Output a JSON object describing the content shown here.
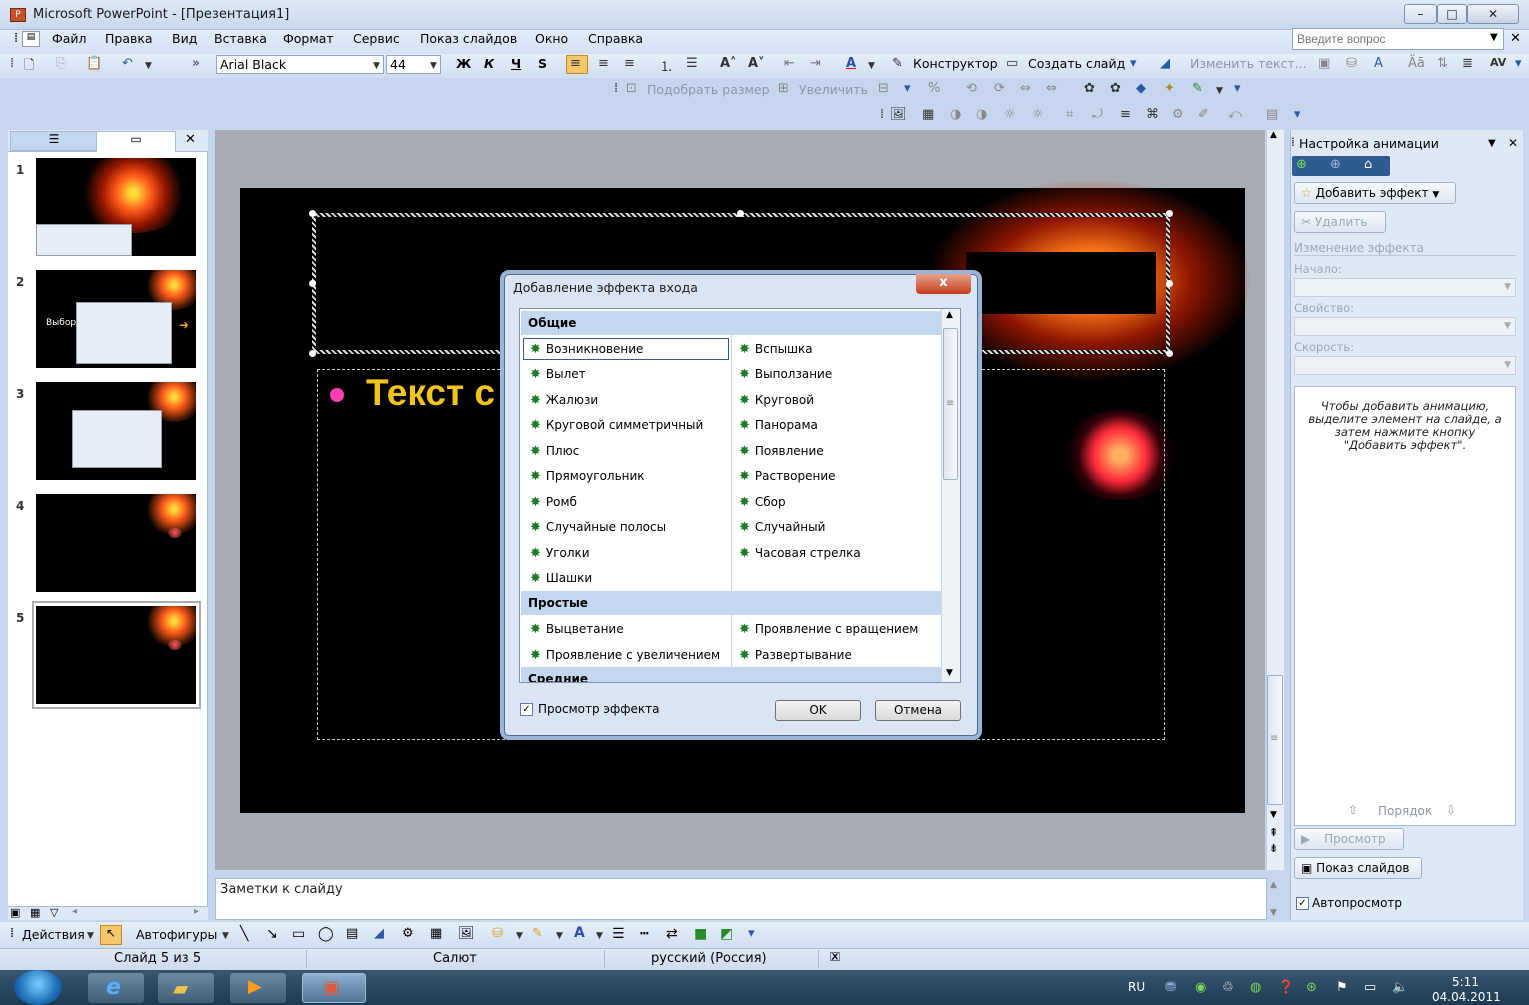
{
  "window": {
    "title": "Microsoft PowerPoint - [Презентация1]"
  },
  "menu": [
    "Файл",
    "Правка",
    "Вид",
    "Вставка",
    "Формат",
    "Сервис",
    "Показ слайдов",
    "Окно",
    "Справка"
  ],
  "help": {
    "placeholder": "Введите вопрос"
  },
  "toolbar": {
    "font_name": "Arial Black",
    "font_size": "44",
    "bold": "Ж",
    "italic": "К",
    "underline": "Ч",
    "shadow": "S",
    "designer": "Конструктор",
    "new_slide": "Создать слайд",
    "edit_text": "Изменить текст...",
    "fit_size": "Подобрать размер",
    "zoom": "Увеличить"
  },
  "slides": {
    "numbers": [
      "1",
      "2",
      "3",
      "4",
      "5"
    ],
    "current": 5,
    "thumb2_text": "Выбор"
  },
  "slide": {
    "bullet_text": "Текст с"
  },
  "notes": {
    "placeholder": "Заметки к слайду"
  },
  "dialog": {
    "title": "Добавление эффекта входа",
    "close": "x",
    "categories": [
      {
        "name": "Общие",
        "left": [
          "Возникновение",
          "Вылет",
          "Жалюзи",
          "Круговой симметричный",
          "Плюс",
          "Прямоугольник",
          "Ромб",
          "Случайные полосы",
          "Уголки",
          "Шашки"
        ],
        "right": [
          "Вспышка",
          "Выползание",
          "Круговой",
          "Панорама",
          "Появление",
          "Растворение",
          "Сбор",
          "Случайный",
          "Часовая стрелка"
        ]
      },
      {
        "name": "Простые",
        "left": [
          "Выцветание",
          "Проявление с увеличением"
        ],
        "right": [
          "Проявление с вращением",
          "Развертывание"
        ]
      },
      {
        "name": "Средние",
        "left": [],
        "right": []
      }
    ],
    "selected": "Возникновение",
    "preview_label": "Просмотр эффекта",
    "preview_checked": true,
    "ok": "OK",
    "cancel": "Отмена"
  },
  "task_pane": {
    "title": "Настройка анимации",
    "add_effect": "Добавить эффект",
    "remove": "Удалить",
    "change_effect": "Изменение эффекта",
    "start_label": "Начало:",
    "property_label": "Свойство:",
    "speed_label": "Скорость:",
    "hint": "Чтобы добавить анимацию, выделите элемент на слайде, а затем нажмите кнопку \"Добавить эффект\".",
    "order": "Порядок",
    "preview": "Просмотр",
    "slideshow": "Показ слайдов",
    "autopreview": "Автопросмотр"
  },
  "drawing": {
    "actions": "Действия",
    "autoshapes": "Автофигуры"
  },
  "status": {
    "slide": "Слайд 5 из 5",
    "design": "Салют",
    "language": "русский (Россия)"
  },
  "taskbar": {
    "lang": "RU",
    "time": "5:11",
    "date": "04.04.2011"
  },
  "colors": {
    "accent": "#c4d7f0",
    "bullet": "#ff3fb2",
    "slide_text": "#f3c51a",
    "firework": "#ff5a1a"
  }
}
